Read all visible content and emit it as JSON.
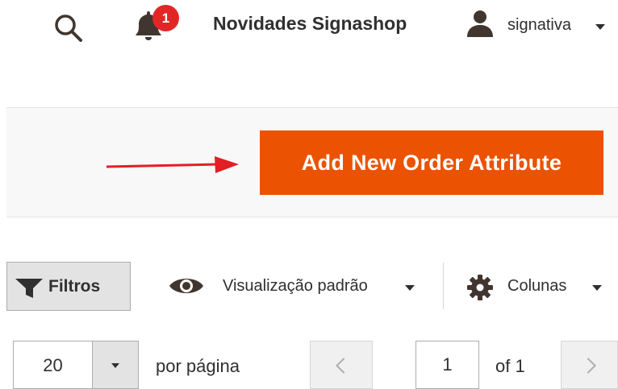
{
  "header": {
    "search_icon": "search-icon",
    "notifications": {
      "icon": "bell-icon",
      "count": "1",
      "badge_color": "#e22626"
    },
    "store_link": "Novidades Signashop",
    "account": {
      "icon": "user-icon",
      "name": "signativa"
    }
  },
  "page_actions": {
    "primary_button": "Add New Order Attribute",
    "primary_color": "#eb5202",
    "annotation_arrow_color": "#e31e24"
  },
  "toolbar": {
    "filters_label": "Filtros",
    "view_label": "Visualização padrão",
    "columns_label": "Colunas"
  },
  "pager": {
    "per_page_value": "20",
    "per_page_label": "por página",
    "current_page": "1",
    "total_label": "of 1"
  }
}
